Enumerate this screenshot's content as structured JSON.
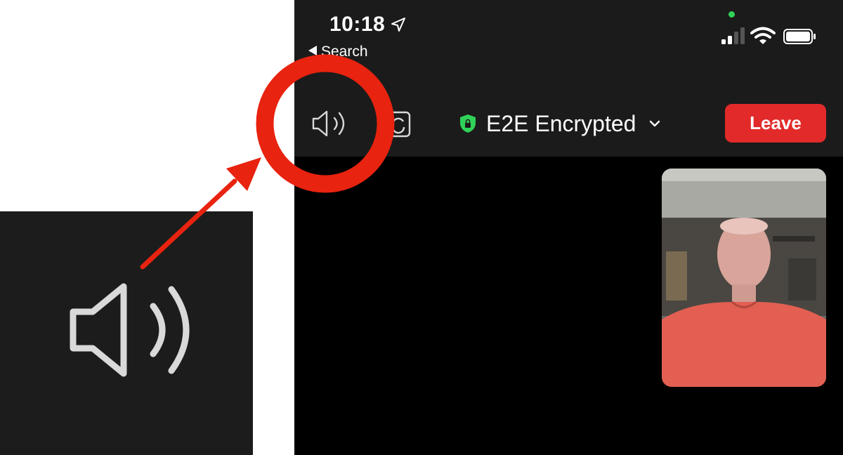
{
  "status_bar": {
    "time": "10:18",
    "back_label": "Search"
  },
  "meeting_bar": {
    "title": "E2E Encrypted",
    "leave_label": "Leave"
  },
  "icons": {
    "speaker": "speaker-icon",
    "camera_switch": "camera-switch-icon",
    "shield": "shield-lock-icon",
    "chevron": "chevron-down-icon",
    "signal": "cellular-signal-icon",
    "wifi": "wifi-icon",
    "battery": "battery-icon",
    "location": "location-arrow-icon"
  },
  "colors": {
    "leave_button": "#e22a2a",
    "shield": "#30d158",
    "highlight_ring": "#e8230f",
    "top_bar": "#1b1b1b"
  }
}
